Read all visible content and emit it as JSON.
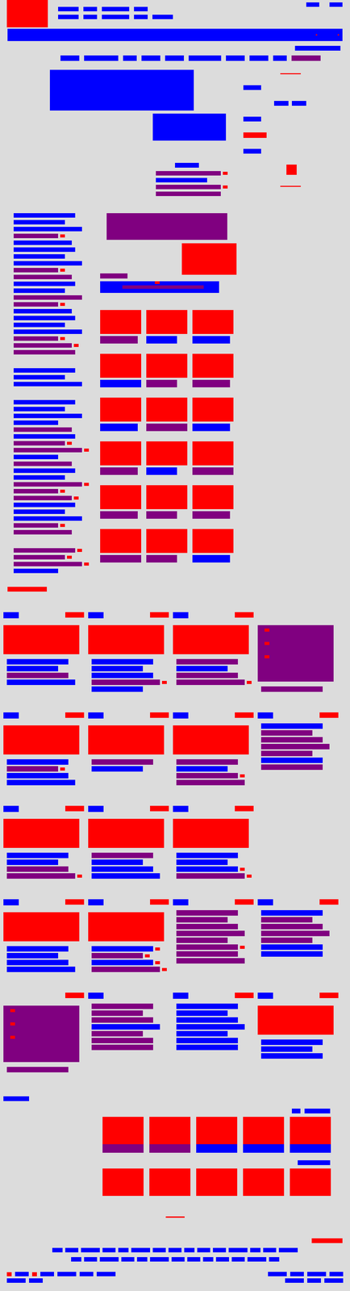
{
  "header": {
    "logo": "image",
    "nav_rows": [
      [
        "link",
        "link",
        "link",
        "link"
      ],
      [
        "link",
        "link",
        "link",
        "link",
        "link"
      ]
    ],
    "utility_links": [
      "link",
      "link"
    ]
  },
  "banner": {
    "kind": "link",
    "marks": [
      "image",
      "image"
    ]
  },
  "banner_link": "link",
  "menu": [
    "link",
    "link",
    "link",
    "link",
    "link",
    "link",
    "link",
    "link",
    "link",
    "text"
  ],
  "hero": {
    "main": "link",
    "secondary": "link",
    "caption": "link",
    "lines": [
      {
        "kind": "text",
        "mark": true
      },
      {
        "kind": "link",
        "mark": false
      },
      {
        "kind": "text",
        "mark": true
      },
      {
        "kind": "text",
        "mark": false
      }
    ]
  },
  "aside": [
    "rule",
    "link",
    "link-pair",
    "link",
    "button",
    "link",
    "square",
    "rule"
  ],
  "side_list": [
    [
      {
        "kind": "link",
        "mark": false
      },
      {
        "kind": "link",
        "mark": false
      },
      {
        "kind": "link",
        "mark": false
      },
      {
        "kind": "text",
        "mark": true
      },
      {
        "kind": "link",
        "mark": false
      },
      {
        "kind": "link",
        "mark": false
      },
      {
        "kind": "link",
        "mark": false
      },
      {
        "kind": "link",
        "mark": false
      },
      {
        "kind": "text",
        "mark": true
      },
      {
        "kind": "text",
        "mark": false
      },
      {
        "kind": "link",
        "mark": false
      },
      {
        "kind": "link",
        "mark": false
      },
      {
        "kind": "text",
        "mark": false
      },
      {
        "kind": "text",
        "mark": true
      },
      {
        "kind": "link",
        "mark": false
      },
      {
        "kind": "link",
        "mark": false
      },
      {
        "kind": "link",
        "mark": false
      },
      {
        "kind": "link",
        "mark": false
      },
      {
        "kind": "text",
        "mark": true
      },
      {
        "kind": "text",
        "mark": true
      },
      {
        "kind": "text",
        "mark": false
      }
    ],
    [
      {
        "kind": "link",
        "mark": false
      },
      {
        "kind": "link",
        "mark": false
      },
      {
        "kind": "link",
        "mark": false
      }
    ],
    [
      {
        "kind": "link",
        "mark": false
      },
      {
        "kind": "link",
        "mark": false
      },
      {
        "kind": "link",
        "mark": false
      },
      {
        "kind": "link",
        "mark": false
      },
      {
        "kind": "text",
        "mark": false
      },
      {
        "kind": "link",
        "mark": false
      },
      {
        "kind": "text",
        "mark": true
      },
      {
        "kind": "text",
        "mark": true
      },
      {
        "kind": "link",
        "mark": false
      },
      {
        "kind": "text",
        "mark": false
      },
      {
        "kind": "link",
        "mark": false
      },
      {
        "kind": "link",
        "mark": false
      },
      {
        "kind": "text",
        "mark": true
      },
      {
        "kind": "text",
        "mark": true
      },
      {
        "kind": "text",
        "mark": true
      },
      {
        "kind": "link",
        "mark": false
      },
      {
        "kind": "link",
        "mark": false
      },
      {
        "kind": "link",
        "mark": false
      },
      {
        "kind": "text",
        "mark": true
      },
      {
        "kind": "text",
        "mark": false
      }
    ],
    [
      {
        "kind": "text",
        "mark": true
      },
      {
        "kind": "text",
        "mark": true
      },
      {
        "kind": "text",
        "mark": true
      },
      {
        "kind": "link",
        "mark": false
      }
    ]
  ],
  "side_button": "image",
  "feature": {
    "text_block": "text",
    "image": "image",
    "label": "text",
    "bar": {
      "kind": "link",
      "inner": "text",
      "mark": "image"
    }
  },
  "grid": [
    [
      {
        "image": "image",
        "caption": "text"
      },
      {
        "image": "image",
        "caption": "link"
      },
      {
        "image": "image",
        "caption": "link"
      }
    ],
    [
      {
        "image": "image",
        "caption": "link"
      },
      {
        "image": "image",
        "caption": "text"
      },
      {
        "image": "image",
        "caption": "text"
      }
    ],
    [
      {
        "image": "image",
        "caption": "link"
      },
      {
        "image": "image",
        "caption": "text"
      },
      {
        "image": "image",
        "caption": "link"
      }
    ],
    [
      {
        "image": "image",
        "caption": "text"
      },
      {
        "image": "image",
        "caption": "link"
      },
      {
        "image": "image",
        "caption": "text"
      }
    ],
    [
      {
        "image": "image",
        "caption": "text"
      },
      {
        "image": "image",
        "caption": "text"
      },
      {
        "image": "image",
        "caption": "text"
      }
    ],
    [
      {
        "image": "image",
        "caption": "text"
      },
      {
        "image": "image",
        "caption": "text"
      },
      {
        "image": "image",
        "caption": "link"
      }
    ]
  ],
  "card_sections": [
    [
      {
        "head": [
          "link",
          "image"
        ],
        "media": "image",
        "lines": [
          {
            "kind": "link",
            "mark": false
          },
          {
            "kind": "link",
            "mark": false
          },
          {
            "kind": "text",
            "mark": false
          },
          {
            "kind": "link",
            "mark": false
          }
        ]
      },
      {
        "head": [
          "link",
          "image"
        ],
        "media": "image",
        "lines": [
          {
            "kind": "link",
            "mark": false
          },
          {
            "kind": "link",
            "mark": false
          },
          {
            "kind": "link",
            "mark": false
          },
          {
            "kind": "text",
            "mark": true
          },
          {
            "kind": "link",
            "mark": false
          }
        ]
      },
      {
        "head": [
          "link",
          "image"
        ],
        "media": "image",
        "lines": [
          {
            "kind": "text",
            "mark": false
          },
          {
            "kind": "link",
            "mark": false
          },
          {
            "kind": "text",
            "mark": false
          },
          {
            "kind": "text",
            "mark": true
          }
        ]
      },
      {
        "head": [],
        "media": "text",
        "lines": [
          {
            "kind": "text",
            "mark": false
          }
        ]
      }
    ],
    [
      {
        "head": [
          "link",
          "image"
        ],
        "media": "image",
        "lines": [
          {
            "kind": "link",
            "mark": false
          },
          {
            "kind": "text",
            "mark": true
          },
          {
            "kind": "link",
            "mark": false
          },
          {
            "kind": "link",
            "mark": false
          }
        ]
      },
      {
        "head": [
          "link",
          "image"
        ],
        "media": "image",
        "lines": [
          {
            "kind": "text",
            "mark": false
          },
          {
            "kind": "link",
            "mark": false
          }
        ]
      },
      {
        "head": [
          "link",
          "image"
        ],
        "media": "image",
        "lines": [
          {
            "kind": "text",
            "mark": false
          },
          {
            "kind": "link",
            "mark": false
          },
          {
            "kind": "text",
            "mark": true
          },
          {
            "kind": "text",
            "mark": false
          }
        ]
      },
      {
        "head": [
          "link",
          "image"
        ],
        "media": "none",
        "lines": [
          {
            "kind": "link",
            "mark": false
          },
          {
            "kind": "text",
            "mark": false
          },
          {
            "kind": "text",
            "mark": false
          },
          {
            "kind": "text",
            "mark": false
          },
          {
            "kind": "text",
            "mark": false
          },
          {
            "kind": "link",
            "mark": false
          },
          {
            "kind": "text",
            "mark": false
          }
        ]
      }
    ],
    [
      {
        "head": [
          "link",
          "image"
        ],
        "media": "image",
        "lines": [
          {
            "kind": "link",
            "mark": false
          },
          {
            "kind": "link",
            "mark": false
          },
          {
            "kind": "text",
            "mark": false
          },
          {
            "kind": "text",
            "mark": true
          }
        ]
      },
      {
        "head": [
          "link",
          "image"
        ],
        "media": "image",
        "lines": [
          {
            "kind": "text",
            "mark": false
          },
          {
            "kind": "link",
            "mark": false
          },
          {
            "kind": "link",
            "mark": false
          },
          {
            "kind": "link",
            "mark": false
          }
        ]
      },
      {
        "head": [
          "link",
          "image"
        ],
        "media": "image",
        "lines": [
          {
            "kind": "link",
            "mark": false
          },
          {
            "kind": "link",
            "mark": false
          },
          {
            "kind": "link",
            "mark": true
          },
          {
            "kind": "text",
            "mark": true
          }
        ]
      }
    ],
    [
      {
        "head": [
          "link",
          "image"
        ],
        "media": "image",
        "lines": [
          {
            "kind": "link",
            "mark": false
          },
          {
            "kind": "link",
            "mark": false
          },
          {
            "kind": "link",
            "mark": false
          },
          {
            "kind": "link",
            "mark": false
          }
        ]
      },
      {
        "head": [
          "link",
          "image"
        ],
        "media": "image",
        "lines": [
          {
            "kind": "link",
            "mark": true
          },
          {
            "kind": "text",
            "mark": true
          },
          {
            "kind": "link",
            "mark": true
          },
          {
            "kind": "text",
            "mark": true
          }
        ]
      },
      {
        "head": [
          "link",
          "image"
        ],
        "media": "none",
        "lines": [
          {
            "kind": "text",
            "mark": false
          },
          {
            "kind": "text",
            "mark": false
          },
          {
            "kind": "text",
            "mark": false
          },
          {
            "kind": "text",
            "mark": false
          },
          {
            "kind": "text",
            "mark": false
          },
          {
            "kind": "text",
            "mark": true
          },
          {
            "kind": "text",
            "mark": false
          },
          {
            "kind": "text",
            "mark": false
          }
        ]
      },
      {
        "head": [
          "link",
          "image"
        ],
        "media": "none",
        "lines": [
          {
            "kind": "link",
            "mark": false
          },
          {
            "kind": "text",
            "mark": false
          },
          {
            "kind": "text",
            "mark": false
          },
          {
            "kind": "text",
            "mark": false
          },
          {
            "kind": "text",
            "mark": false
          },
          {
            "kind": "link",
            "mark": false
          },
          {
            "kind": "link",
            "mark": false
          }
        ]
      }
    ],
    [
      {
        "head": [
          "image"
        ],
        "media": "text",
        "lines": [
          {
            "kind": "text",
            "mark": false
          }
        ]
      },
      {
        "head": [
          "link"
        ],
        "media": "none",
        "lines": [
          {
            "kind": "text",
            "mark": false
          },
          {
            "kind": "text",
            "mark": false
          },
          {
            "kind": "text",
            "mark": false
          },
          {
            "kind": "link",
            "mark": false
          },
          {
            "kind": "text",
            "mark": false
          },
          {
            "kind": "text",
            "mark": false
          },
          {
            "kind": "text",
            "mark": false
          }
        ]
      },
      {
        "head": [
          "link",
          "image"
        ],
        "media": "none",
        "lines": [
          {
            "kind": "link",
            "mark": false
          },
          {
            "kind": "link",
            "mark": false
          },
          {
            "kind": "link",
            "mark": false
          },
          {
            "kind": "link",
            "mark": false
          },
          {
            "kind": "link",
            "mark": false
          },
          {
            "kind": "link",
            "mark": false
          },
          {
            "kind": "link",
            "mark": false
          }
        ]
      },
      {
        "head": [
          "link",
          "image"
        ],
        "media": "image",
        "lines": [
          {
            "kind": "link",
            "mark": false
          },
          {
            "kind": "link",
            "mark": false
          },
          {
            "kind": "link",
            "mark": false
          }
        ]
      }
    ]
  ],
  "more_label": "link",
  "gallery": {
    "links": [
      "link",
      "link"
    ],
    "tiles": [
      {
        "image": "image",
        "caption": "text"
      },
      {
        "image": "image",
        "caption": "text"
      },
      {
        "image": "image",
        "caption": "link"
      },
      {
        "image": "image",
        "caption": "link"
      },
      {
        "image": "image",
        "caption": "link"
      }
    ],
    "link": "link",
    "tiles2": [
      "image",
      "image",
      "image",
      "image",
      "image"
    ]
  },
  "footer": {
    "rule": "image",
    "button": "image",
    "link_rows": [
      [
        "link",
        "link",
        "link",
        "link",
        "link",
        "link",
        "link",
        "link",
        "link",
        "link",
        "link",
        "link",
        "link",
        "link",
        "link"
      ],
      [
        "link",
        "link",
        "link",
        "link",
        "link",
        "link",
        "link",
        "link",
        "link",
        "link",
        "link",
        "link",
        "link"
      ]
    ],
    "bottom_left": [
      [
        "image",
        "link",
        "image",
        "link",
        "link",
        "link",
        "link"
      ],
      [
        "link",
        "link"
      ]
    ],
    "bottom_right": [
      [
        "link",
        "link",
        "link",
        "link"
      ],
      [
        "link",
        "link",
        "link"
      ]
    ]
  }
}
